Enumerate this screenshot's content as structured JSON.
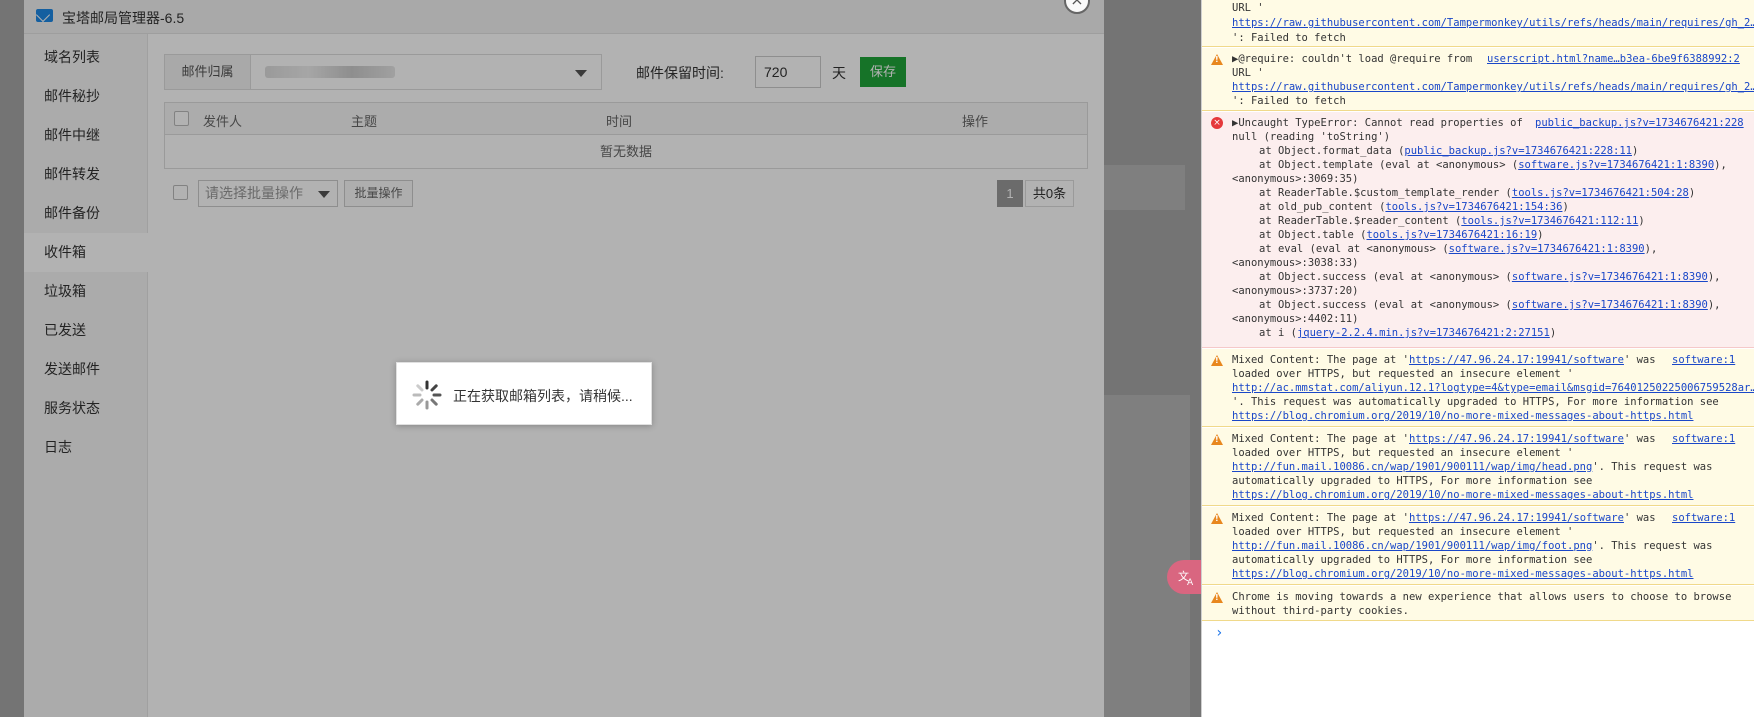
{
  "dialog": {
    "title": "宝塔邮局管理器-6.5",
    "close_icon": "×"
  },
  "sidebar": {
    "items": [
      {
        "label": "域名列表",
        "active": false
      },
      {
        "label": "邮件秘抄",
        "active": false
      },
      {
        "label": "邮件中继",
        "active": false
      },
      {
        "label": "邮件转发",
        "active": false
      },
      {
        "label": "邮件备份",
        "active": false
      },
      {
        "label": "收件箱",
        "active": true
      },
      {
        "label": "垃圾箱",
        "active": false
      },
      {
        "label": "已发送",
        "active": false
      },
      {
        "label": "发送邮件",
        "active": false
      },
      {
        "label": "服务状态",
        "active": false
      },
      {
        "label": "日志",
        "active": false
      }
    ]
  },
  "filter": {
    "owner_label": "邮件归属",
    "retain_label": "邮件保留时间:",
    "retain_value": "720",
    "retain_unit": "天",
    "save_label": "保存"
  },
  "table": {
    "headers": [
      "发件人",
      "主题",
      "时间",
      "操作"
    ],
    "empty_text": "暂无数据"
  },
  "batch": {
    "placeholder": "请选择批量操作",
    "button_label": "批量操作"
  },
  "pagination": {
    "current_page": "1",
    "total_text": "共0条"
  },
  "loading": {
    "text": "正在获取邮箱列表，请稍候..."
  },
  "translate_bubble": {
    "icon": "translate-icon"
  },
  "colors": {
    "accent_green": "#20a53a",
    "warn_bg": "#fffbe5",
    "error_bg": "#fceeee",
    "link": "#1a47c8"
  },
  "console": {
    "m0": {
      "l1": "URL '",
      "l2": "https://raw.githubusercontent.com/Tampermonkey/utils/refs/heads/main/requires/gh_2…",
      "l3": "': Failed to fetch"
    },
    "m1": {
      "l1": "▶@require: couldn't load @require from",
      "src": "userscript.html?name…b3ea-6be9f6388992:2",
      "l2": "URL '",
      "l3": "https://raw.githubusercontent.com/Tampermonkey/utils/refs/heads/main/requires/gh_2…",
      "l4": "': Failed to fetch"
    },
    "m2": {
      "l1": "▶Uncaught TypeError: Cannot read properties of",
      "src": "public_backup.js?v=1734676421:228",
      "l2": "null (reading 'toString')",
      "s1a": "at Object.format_data (",
      "s1b": "public_backup.js?v=1734676421:228:11",
      "s1c": ")",
      "s2a": "at Object.template (eval at <anonymous> (",
      "s2b": "software.js?v=1734676421:1:8390",
      "s2c": "),",
      "s2d": "<anonymous>:3069:35)",
      "s3a": "at ReaderTable.$custom_template_render (",
      "s3b": "tools.js?v=1734676421:504:28",
      "s3c": ")",
      "s4a": "at old_pub_content (",
      "s4b": "tools.js?v=1734676421:154:36",
      "s4c": ")",
      "s5a": "at ReaderTable.$reader_content (",
      "s5b": "tools.js?v=1734676421:112:11",
      "s5c": ")",
      "s6a": "at Object.table (",
      "s6b": "tools.js?v=1734676421:16:19",
      "s6c": ")",
      "s7a": "at eval (eval at <anonymous> (",
      "s7b": "software.js?v=1734676421:1:8390",
      "s7c": "),",
      "s7d": "<anonymous>:3038:33)",
      "s8a": "at Object.success (eval at <anonymous> (",
      "s8b": "software.js?v=1734676421:1:8390",
      "s8c": "),",
      "s8d": "<anonymous>:3737:20)",
      "s9a": "at Object.success (eval at <anonymous> (",
      "s9b": "software.js?v=1734676421:1:8390",
      "s9c": "),",
      "s9d": "<anonymous>:4402:11)",
      "s10a": "at i (",
      "s10b": "jquery-2.2.4.min.js?v=1734676421:2:27151",
      "s10c": ")"
    },
    "m3": {
      "a": "Mixed Content: The page at '",
      "b": "https://47.96.24.17:19941/software",
      "c": "' was",
      "src": "software:1",
      "l2": "loaded over HTTPS, but requested an insecure element '",
      "l3": "http://ac.mmstat.com/aliyun.12.1?logtype=4&type=email&msgid=76401250225006759528ar…",
      "l4": "'. This request was automatically upgraded to HTTPS, For more information see",
      "l5": "https://blog.chromium.org/2019/10/no-more-mixed-messages-about-https.html"
    },
    "m4": {
      "a": "Mixed Content: The page at '",
      "b": "https://47.96.24.17:19941/software",
      "c": "' was",
      "src": "software:1",
      "l2": "loaded over HTTPS, but requested an insecure element '",
      "l3a": "http://fun.mail.10086.cn/wap/1901/900111/wap/img/head.png",
      "l3b": "'. This request was",
      "l4": "automatically upgraded to HTTPS, For more information see",
      "l5": "https://blog.chromium.org/2019/10/no-more-mixed-messages-about-https.html"
    },
    "m5": {
      "a": "Mixed Content: The page at '",
      "b": "https://47.96.24.17:19941/software",
      "c": "' was",
      "src": "software:1",
      "l2": "loaded over HTTPS, but requested an insecure element '",
      "l3a": "http://fun.mail.10086.cn/wap/1901/900111/wap/img/foot.png",
      "l3b": "'. This request was",
      "l4": "automatically upgraded to HTTPS, For more information see",
      "l5": "https://blog.chromium.org/2019/10/no-more-mixed-messages-about-https.html"
    },
    "m6": {
      "l1": "Chrome is moving towards a new experience that allows users to choose to browse",
      "l2": "without third-party cookies."
    },
    "prompt": "›"
  }
}
